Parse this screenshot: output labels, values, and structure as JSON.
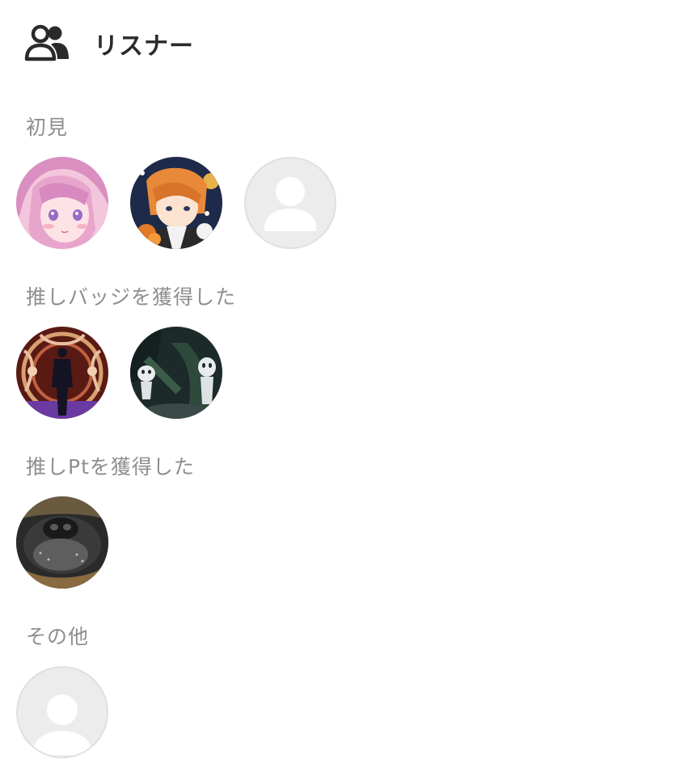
{
  "header": {
    "icon": "users-icon",
    "title": "リスナー"
  },
  "sections": [
    {
      "label": "初見",
      "avatars": [
        "anime-pink-hair",
        "anime-orange-hair",
        "default-user"
      ]
    },
    {
      "label": "推しバッジを獲得した",
      "avatars": [
        "silhouette-ornate",
        "kodama-forest"
      ]
    },
    {
      "label": "推しPtを獲得した",
      "avatars": [
        "dog-closeup"
      ]
    },
    {
      "label": "その他",
      "avatars": [
        "default-user"
      ]
    }
  ],
  "colors": {
    "text_primary": "#2a2a2a",
    "text_secondary": "#8e8e8e",
    "placeholder_bg": "#ececec",
    "placeholder_fg": "#ffffff"
  }
}
